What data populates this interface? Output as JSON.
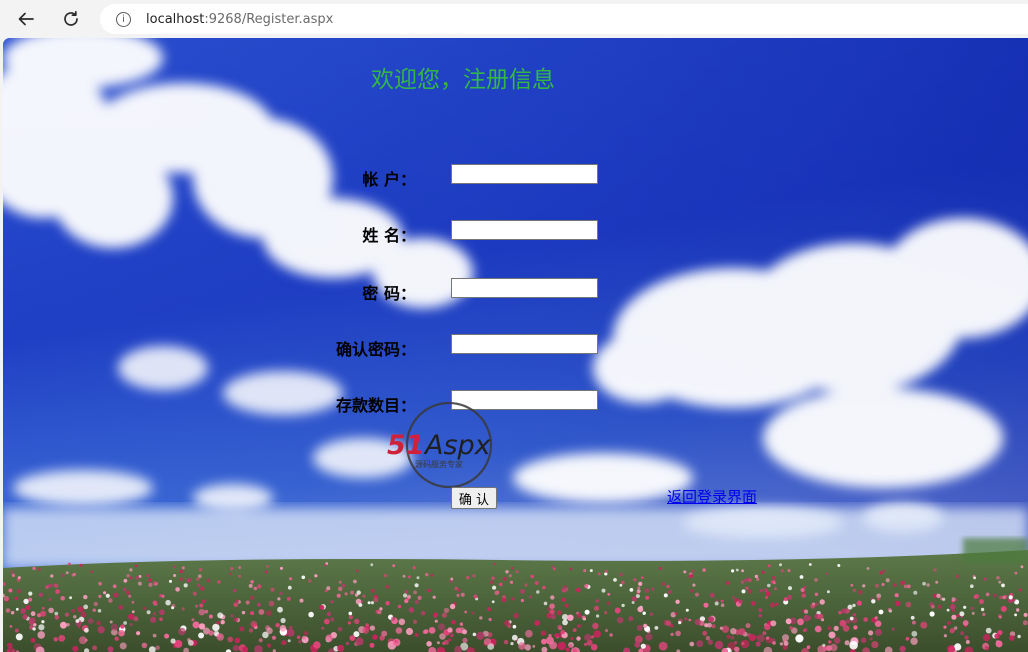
{
  "browser": {
    "url_host": "localhost",
    "url_rest": ":9268/Register.aspx",
    "back_icon": "back-arrow-icon",
    "reload_icon": "reload-icon",
    "info_icon": "info-icon"
  },
  "page": {
    "title": "欢迎您，注册信息",
    "fields": [
      {
        "label": "帐 户：",
        "value": ""
      },
      {
        "label": "姓 名：",
        "value": ""
      },
      {
        "label": "密 码：",
        "value": ""
      },
      {
        "label": "确认密码：",
        "value": ""
      },
      {
        "label": "存款数目：",
        "value": ""
      }
    ],
    "confirm_label": "确 认",
    "back_link": "返回登录界面",
    "watermark": {
      "brand": "51Aspx",
      "tagline": "源码服务专家"
    },
    "colors": {
      "title": "#33b844",
      "link": "#0000ee"
    }
  }
}
